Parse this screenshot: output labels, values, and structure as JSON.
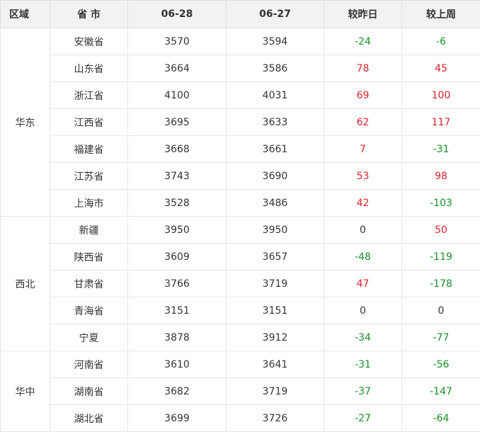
{
  "headers": {
    "region": "区域",
    "province": "省 市",
    "date1": "06-28",
    "date2": "06-27",
    "vs_yesterday": "较昨日",
    "vs_last_week": "较上周"
  },
  "colors": {
    "increase": "#d9232d",
    "decrease": "#1a8f2a",
    "header_bg": "#f2f2f2"
  },
  "groups": [
    {
      "region": "华东",
      "rows": [
        {
          "province": "安徽省",
          "d1": "3570",
          "d2": "3594",
          "dy": "-24",
          "dw": "-6"
        },
        {
          "province": "山东省",
          "d1": "3664",
          "d2": "3586",
          "dy": "78",
          "dw": "45"
        },
        {
          "province": "浙江省",
          "d1": "4100",
          "d2": "4031",
          "dy": "69",
          "dw": "100"
        },
        {
          "province": "江西省",
          "d1": "3695",
          "d2": "3633",
          "dy": "62",
          "dw": "117"
        },
        {
          "province": "福建省",
          "d1": "3668",
          "d2": "3661",
          "dy": "7",
          "dw": "-31"
        },
        {
          "province": "江苏省",
          "d1": "3743",
          "d2": "3690",
          "dy": "53",
          "dw": "98"
        },
        {
          "province": "上海市",
          "d1": "3528",
          "d2": "3486",
          "dy": "42",
          "dw": "-103"
        }
      ]
    },
    {
      "region": "西北",
      "rows": [
        {
          "province": "新疆",
          "d1": "3950",
          "d2": "3950",
          "dy": "0",
          "dw": "50"
        },
        {
          "province": "陕西省",
          "d1": "3609",
          "d2": "3657",
          "dy": "-48",
          "dw": "-119"
        },
        {
          "province": "甘肃省",
          "d1": "3766",
          "d2": "3719",
          "dy": "47",
          "dw": "-178"
        },
        {
          "province": "青海省",
          "d1": "3151",
          "d2": "3151",
          "dy": "0",
          "dw": "0"
        },
        {
          "province": "宁夏",
          "d1": "3878",
          "d2": "3912",
          "dy": "-34",
          "dw": "-77"
        }
      ]
    },
    {
      "region": "华中",
      "rows": [
        {
          "province": "河南省",
          "d1": "3610",
          "d2": "3641",
          "dy": "-31",
          "dw": "-56"
        },
        {
          "province": "湖南省",
          "d1": "3682",
          "d2": "3719",
          "dy": "-37",
          "dw": "-147"
        },
        {
          "province": "湖北省",
          "d1": "3699",
          "d2": "3726",
          "dy": "-27",
          "dw": "-64"
        }
      ]
    }
  ]
}
